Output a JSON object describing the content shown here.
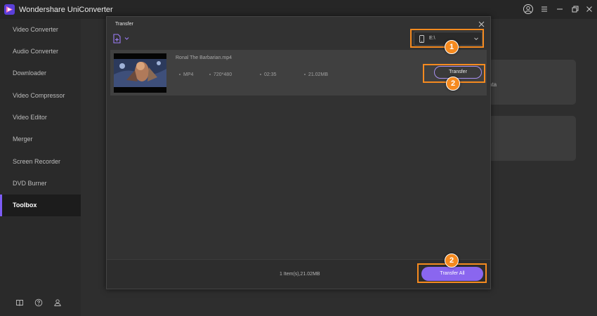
{
  "app": {
    "title": "Wondershare UniConverter",
    "accent_color": "#7d5cf5"
  },
  "window_controls": [
    "user-icon",
    "menu-icon",
    "minimize-icon",
    "restore-icon",
    "close-icon"
  ],
  "sidebar": {
    "items": [
      {
        "label": "Video Converter",
        "active": false
      },
      {
        "label": "Audio Converter",
        "active": false
      },
      {
        "label": "Downloader",
        "active": false
      },
      {
        "label": "Video Compressor",
        "active": false
      },
      {
        "label": "Video Editor",
        "active": false
      },
      {
        "label": "Merger",
        "active": false
      },
      {
        "label": "Screen Recorder",
        "active": false
      },
      {
        "label": "DVD Burner",
        "active": false
      },
      {
        "label": "Toolbox",
        "active": true
      }
    ],
    "bottom_icons": [
      "book-icon",
      "help-icon",
      "account-icon"
    ]
  },
  "background": {
    "card_text": "ata"
  },
  "dialog": {
    "title": "Transfer",
    "device": {
      "value": "E:\\",
      "icon": "phone-icon"
    },
    "file": {
      "name": "Ronal The Barbarian.mp4",
      "format": "MP4",
      "resolution": "720*480",
      "duration": "02:35",
      "size": "21.02MB",
      "transfer_label": "Transfer"
    },
    "footer": {
      "summary": "1 Item(s),21.02MB",
      "transfer_all_label": "Transfer All"
    }
  },
  "callouts": {
    "device_select": "1",
    "transfer_button": "2",
    "transfer_all_button": "2"
  },
  "colors": {
    "callout": "#f58a1f",
    "button_primary": "#8a66ef"
  }
}
